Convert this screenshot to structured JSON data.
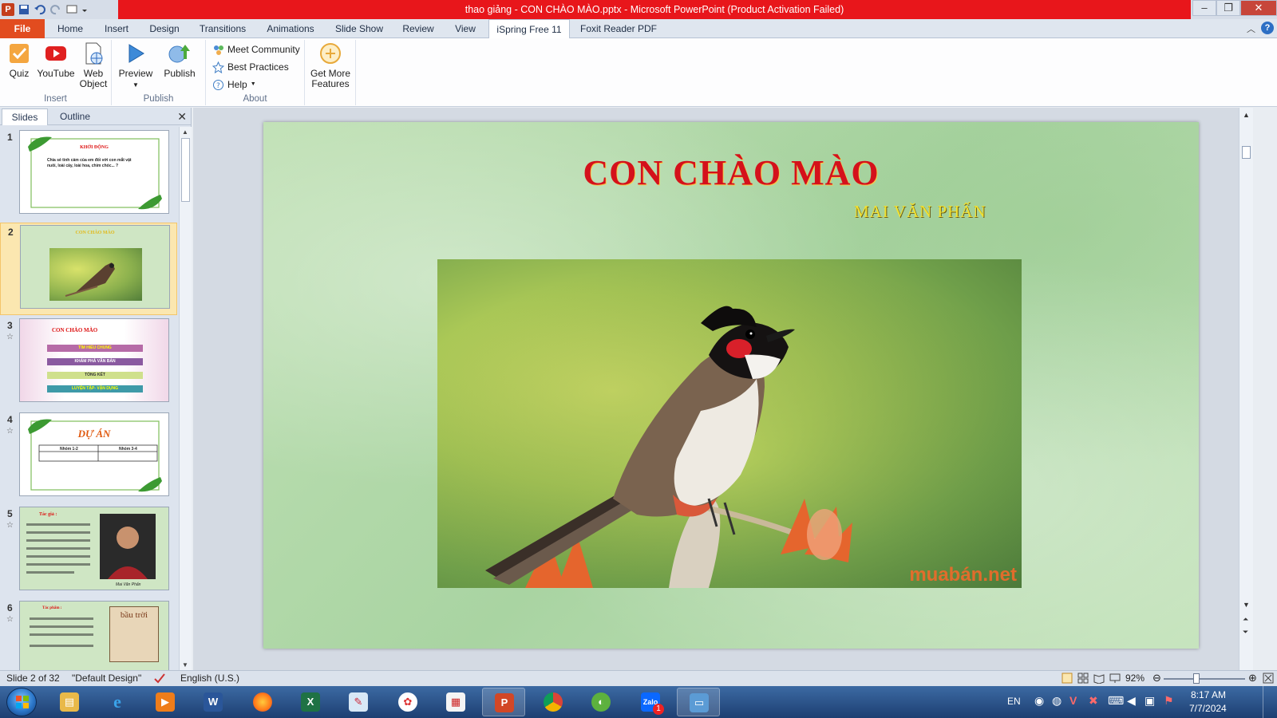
{
  "window": {
    "title": "thao giảng - CON CHÀO MÀO.pptx - Microsoft PowerPoint (Product Activation Failed)",
    "app_icon": "P"
  },
  "tabs": [
    {
      "label": "File",
      "name": "tab-file"
    },
    {
      "label": "Home",
      "name": "tab-home"
    },
    {
      "label": "Insert",
      "name": "tab-insert"
    },
    {
      "label": "Design",
      "name": "tab-design"
    },
    {
      "label": "Transitions",
      "name": "tab-transitions"
    },
    {
      "label": "Animations",
      "name": "tab-animations"
    },
    {
      "label": "Slide Show",
      "name": "tab-slide-show"
    },
    {
      "label": "Review",
      "name": "tab-review"
    },
    {
      "label": "View",
      "name": "tab-view"
    },
    {
      "label": "iSpring Free 11",
      "name": "tab-ispring"
    },
    {
      "label": "Foxit Reader PDF",
      "name": "tab-foxit"
    }
  ],
  "ribbon": {
    "insert_group": "Insert",
    "publish_group": "Publish",
    "about_group": "About",
    "quiz": "Quiz",
    "youtube": "YouTube",
    "web_object_1": "Web",
    "web_object_2": "Object",
    "preview": "Preview",
    "publish": "Publish",
    "meet_community": "Meet Community",
    "best_practices": "Best Practices",
    "help": "Help",
    "get_more_1": "Get More",
    "get_more_2": "Features"
  },
  "panel": {
    "tab_slides": "Slides",
    "tab_outline": "Outline",
    "slides": [
      {
        "num": "1",
        "title": "KHỞI ĐỘNG",
        "line1": "Chia sẻ tình cảm của em đối với con mắt vật",
        "line2": "nuôi, loài cây, loài hoa, chim chóc... ?"
      },
      {
        "num": "2",
        "title": "CON CHÀO MÀO"
      },
      {
        "num": "3",
        "title": "CON CHÀO MÀO",
        "items": [
          "TÌM HIỂU CHUNG",
          "KHÁM PHÁ VĂN BẢN",
          "TỔNG KẾT",
          "LUYỆN TẬP- VẬN DỤNG"
        ]
      },
      {
        "num": "4",
        "title": "DỰ ÁN",
        "col1": "Nhóm 1-2",
        "col2": "Nhóm 3-4"
      },
      {
        "num": "5",
        "title": "Tác giả :",
        "caption": "Mai Văn Phấn"
      },
      {
        "num": "6",
        "title": "Tác phẩm :",
        "book": "bầu trời"
      }
    ]
  },
  "slide": {
    "title": "CON CHÀO MÀO",
    "author": "MAI VĂN PHẤN",
    "watermark": "muabán.net"
  },
  "status": {
    "slide_info": "Slide 2 of 32",
    "theme": "\"Default Design\"",
    "language": "English (U.S.)",
    "zoom": "92%"
  },
  "taskbar": {
    "lang": "EN",
    "time": "8:17 AM",
    "date": "7/7/2024",
    "zalo_badge": "1"
  },
  "colors": {
    "title_bar_red": "#e8161b",
    "file_tab": "#e24c1f",
    "slide_title": "#d4111b",
    "slide_author": "#f2e231"
  }
}
